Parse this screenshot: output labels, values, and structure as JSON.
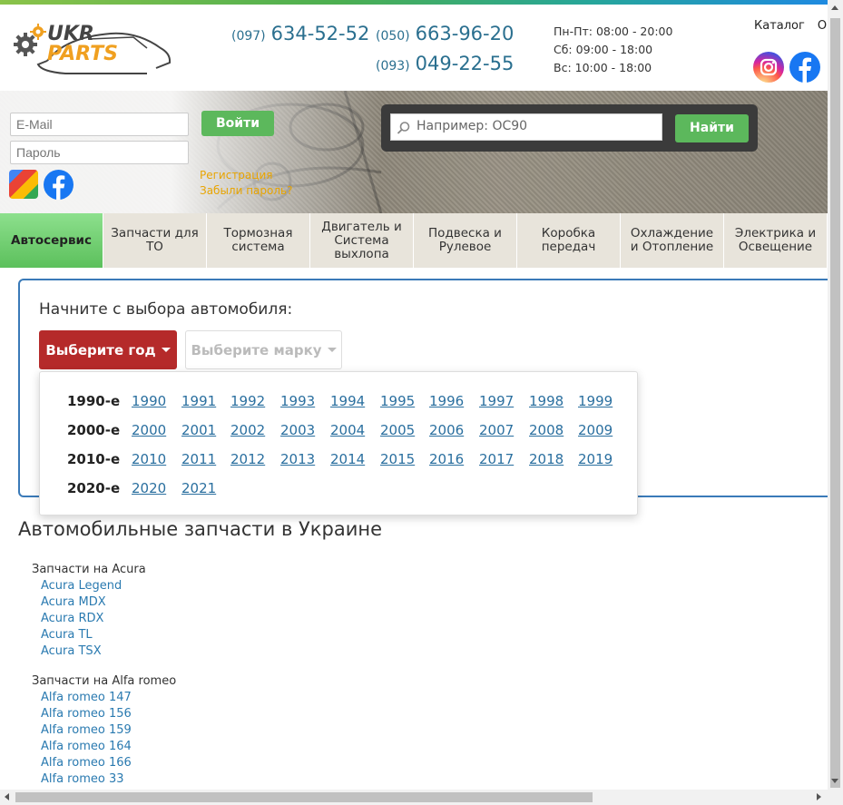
{
  "header": {
    "logo_top": "UKR",
    "logo_bottom": "PARTS",
    "phones": [
      {
        "code": "(097)",
        "number": "634-52-52"
      },
      {
        "code": "(050)",
        "number": "663-96-20"
      },
      {
        "code": "(093)",
        "number": "049-22-55"
      }
    ],
    "hours": [
      "Пн-Пт: 08:00 - 20:00",
      "Сб: 09:00 - 18:00",
      "Вс: 10:00 - 18:00"
    ],
    "links": [
      "Каталог",
      "Оп"
    ]
  },
  "login": {
    "email_placeholder": "E-Mail",
    "password_placeholder": "Пароль",
    "login_label": "Войти",
    "register_label": "Регистрация",
    "forgot_label": "Забыли пароль?"
  },
  "search": {
    "placeholder": "Например: OC90",
    "button_label": "Найти"
  },
  "nav": {
    "tabs": [
      "Автосервис",
      "Запчасти для ТО",
      "Тормозная система",
      "Двигатель и Система выхлопа",
      "Подвеска и Рулевое",
      "Коробка передач",
      "Охлаждение и Отопление",
      "Электрика и Освещение"
    ]
  },
  "selector": {
    "title": "Начните с выбора автомобиля:",
    "year_button": "Выберите год",
    "make_button": "Выберите марку",
    "decades": [
      {
        "label": "1990-е",
        "years": [
          "1990",
          "1991",
          "1992",
          "1993",
          "1994",
          "1995",
          "1996",
          "1997",
          "1998",
          "1999"
        ]
      },
      {
        "label": "2000-е",
        "years": [
          "2000",
          "2001",
          "2002",
          "2003",
          "2004",
          "2005",
          "2006",
          "2007",
          "2008",
          "2009"
        ]
      },
      {
        "label": "2010-е",
        "years": [
          "2010",
          "2011",
          "2012",
          "2013",
          "2014",
          "2015",
          "2016",
          "2017",
          "2018",
          "2019"
        ]
      },
      {
        "label": "2020-е",
        "years": [
          "2020",
          "2021"
        ]
      }
    ]
  },
  "catalog": {
    "title": "Автомобильные запчасти в Украине",
    "groups": [
      {
        "label": "Запчасти на Acura",
        "items": [
          "Acura Legend",
          "Acura MDX",
          "Acura RDX",
          "Acura TL",
          "Acura TSX"
        ]
      },
      {
        "label": "Запчасти на Alfa romeo",
        "items": [
          "Alfa romeo 147",
          "Alfa romeo 156",
          "Alfa romeo 159",
          "Alfa romeo 164",
          "Alfa romeo 166",
          "Alfa romeo 33"
        ]
      }
    ]
  },
  "colors": {
    "accent_green": "#5cb85c",
    "year_button": "#b52a2a",
    "link_blue": "#2a6f9f",
    "panel_border": "#3a7ab8"
  }
}
